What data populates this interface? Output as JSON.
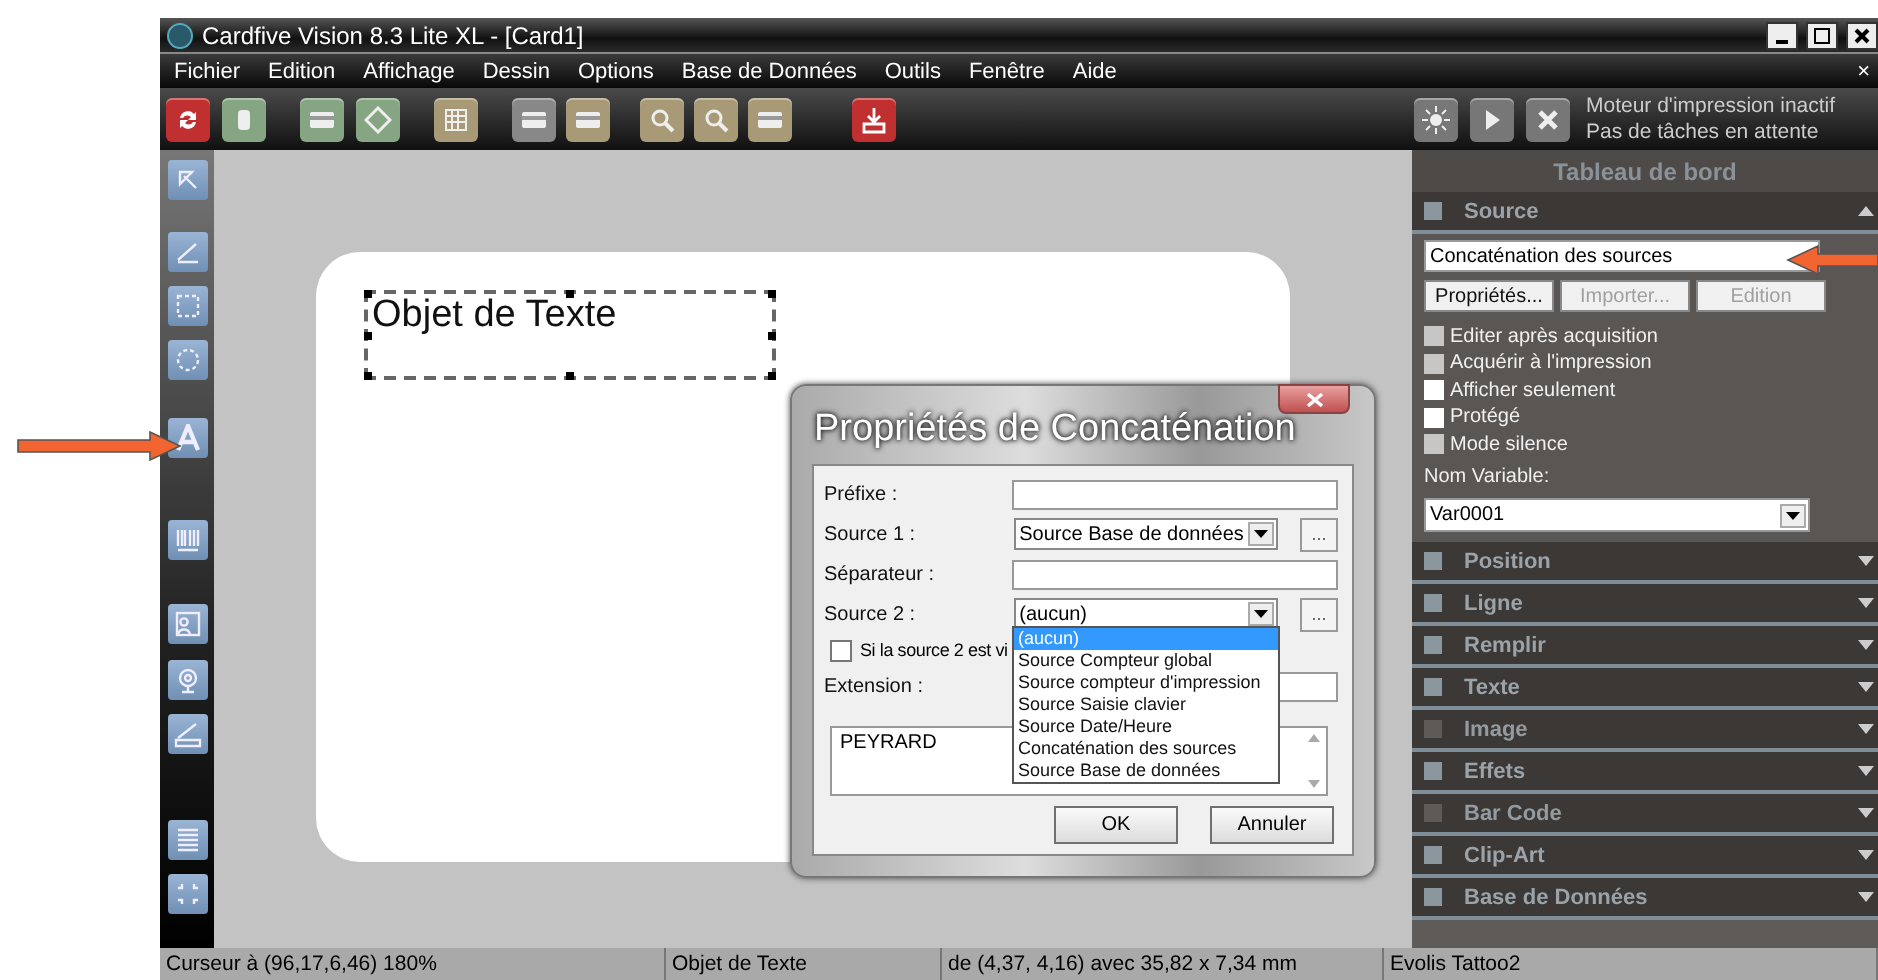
{
  "window": {
    "title": "Cardfive Vision 8.3 Lite XL - [Card1]",
    "menu_close": "×"
  },
  "menu": [
    "Fichier",
    "Edition",
    "Affichage",
    "Dessin",
    "Options",
    "Base de Données",
    "Outils",
    "Fenêtre",
    "Aide"
  ],
  "print_engine": {
    "status": "Moteur d'impression inactif",
    "queue": "Pas de tâches en attente"
  },
  "card": {
    "text_object": "Objet de Texte"
  },
  "dialog": {
    "title": "Propriétés de Concaténation",
    "rows": [
      {
        "kind": "input",
        "label": "Préfixe :"
      },
      {
        "kind": "select",
        "label": "Source 1 :",
        "value": "Source Base de données",
        "browse": "..."
      },
      {
        "kind": "input",
        "label": "Séparateur :"
      },
      {
        "kind": "select",
        "label": "Source 2 :",
        "value": "(aucun)",
        "browse": "..."
      },
      {
        "kind": "checkbox",
        "label": "Si la source 2 est vi",
        "checked": false
      },
      {
        "kind": "input",
        "label": "Extension :"
      }
    ],
    "text_area": "PEYRARD",
    "buttons": [
      "OK",
      "Annuler"
    ],
    "dropdown": [
      {
        "label": "(aucun)",
        "selected": true
      },
      {
        "label": "Source Compteur global",
        "selected": false
      },
      {
        "label": "Source compteur d'impression",
        "selected": false
      },
      {
        "label": "Source Saisie clavier",
        "selected": false
      },
      {
        "label": "Source Date/Heure",
        "selected": false
      },
      {
        "label": "Concaténation des sources",
        "selected": false
      },
      {
        "label": "Source Base de données",
        "selected": false
      }
    ]
  },
  "panel": {
    "title": "Tableau de bord",
    "source": {
      "title": "Source",
      "expanded": true,
      "value": "Concaténation des sources",
      "buttons": [
        {
          "label": "Propriétés...",
          "disabled": false
        },
        {
          "label": "Importer...",
          "disabled": true
        },
        {
          "label": "Edition",
          "disabled": true
        }
      ],
      "options": [
        {
          "label": "Editer après acquisition",
          "checked": false,
          "disabled": true
        },
        {
          "label": "Acquérir à l'impression",
          "checked": false,
          "disabled": true
        },
        {
          "label": "Afficher seulement",
          "checked": false,
          "disabled": false
        },
        {
          "label": "Protégé",
          "checked": false,
          "disabled": false
        },
        {
          "label": "Mode silence",
          "checked": false,
          "disabled": true
        }
      ],
      "variable_label": "Nom Variable:",
      "variable": "Var0001"
    },
    "sections": [
      {
        "title": "Position",
        "expanded": false,
        "disabled": false
      },
      {
        "title": "Ligne",
        "expanded": false,
        "disabled": false
      },
      {
        "title": "Remplir",
        "expanded": false,
        "disabled": false
      },
      {
        "title": "Texte",
        "expanded": false,
        "disabled": false
      },
      {
        "title": "Image",
        "expanded": false,
        "disabled": true
      },
      {
        "title": "Effets",
        "expanded": false,
        "disabled": false
      },
      {
        "title": "Bar Code",
        "expanded": false,
        "disabled": true
      },
      {
        "title": "Clip-Art",
        "expanded": false,
        "disabled": false
      },
      {
        "title": "Base de Données",
        "expanded": false,
        "disabled": false
      }
    ]
  },
  "status_bar": [
    "Curseur à (96,17,6,46) 180%",
    "Objet de Texte",
    "de (4,37, 4,16) avec 35,82 x 7,34 mm",
    "Evolis Tattoo2"
  ]
}
